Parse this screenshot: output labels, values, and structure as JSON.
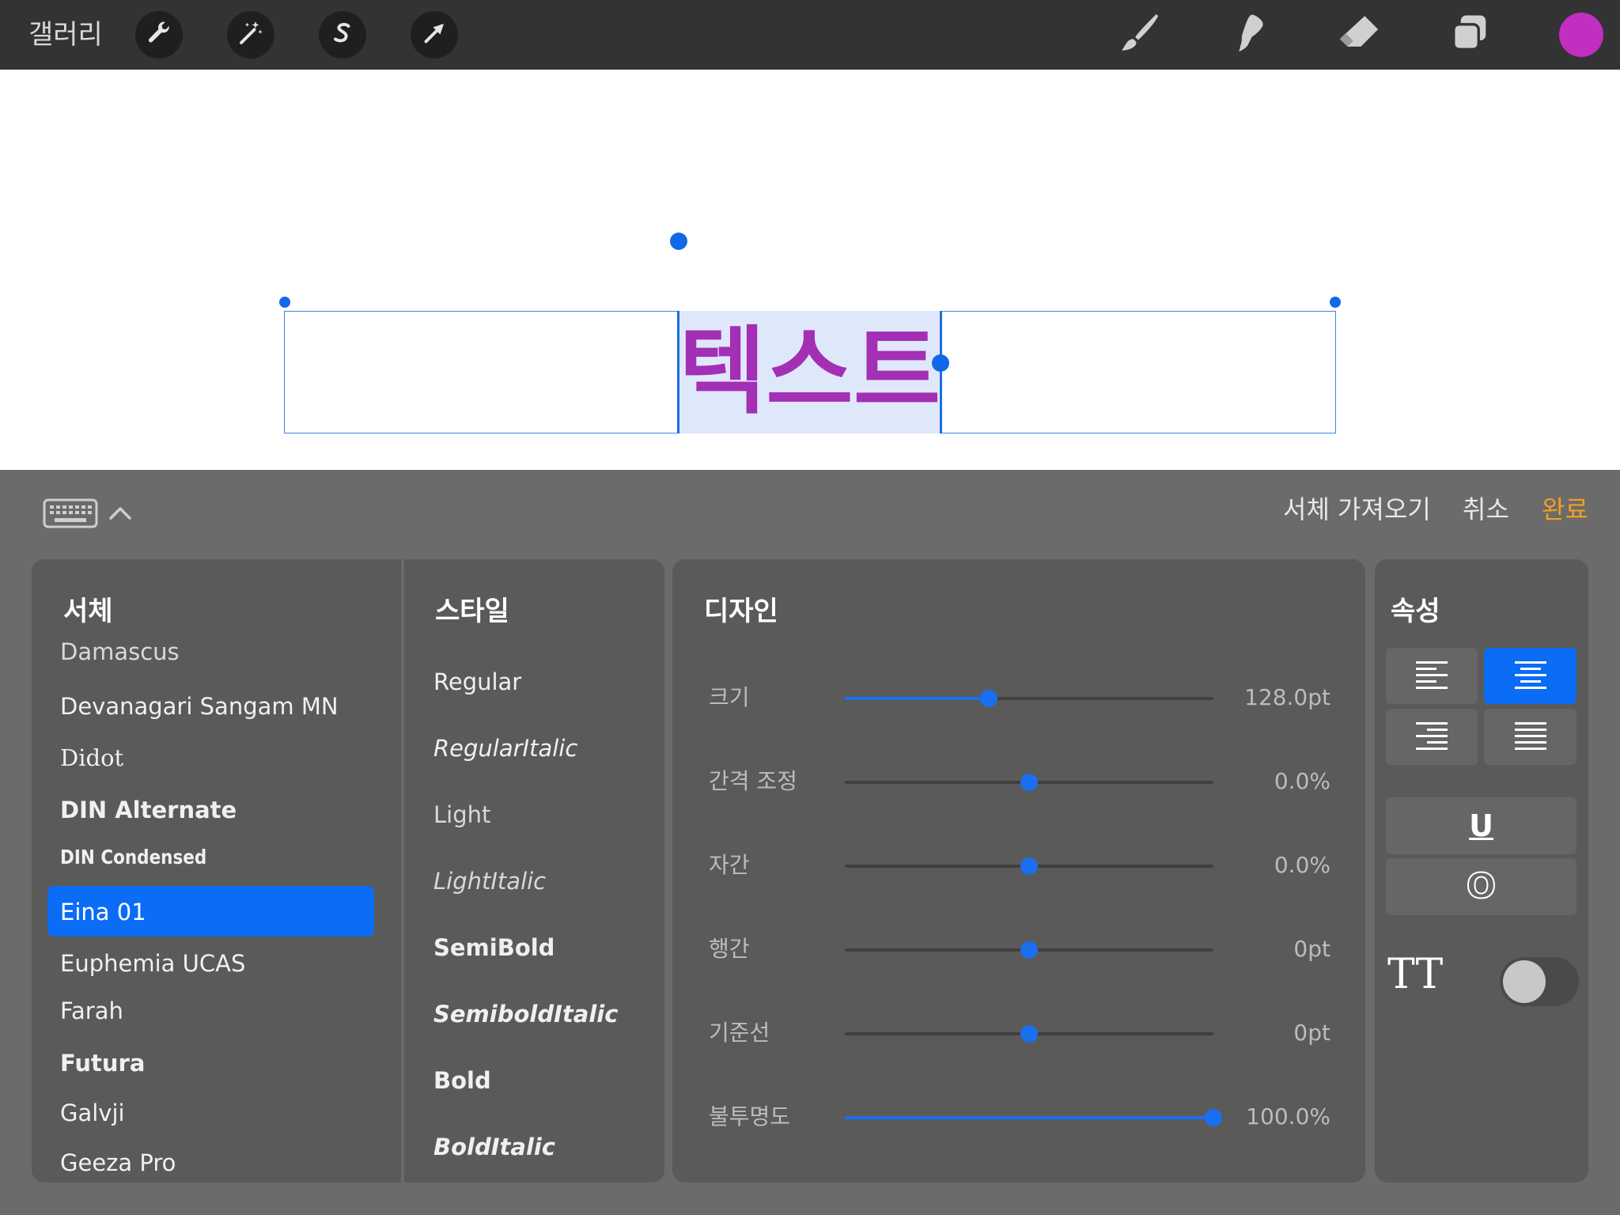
{
  "toolbar": {
    "gallery_label": "갤러리",
    "left_tools": [
      "wrench-icon",
      "magic-wand-icon",
      "selection-s-icon",
      "arrow-icon"
    ],
    "right_tools": [
      "brush-icon",
      "smudge-icon",
      "eraser-icon",
      "layers-icon"
    ],
    "current_color": "#c02fc0"
  },
  "canvas": {
    "text": "텍스트",
    "text_color": "#a32fb5"
  },
  "panel": {
    "actions": {
      "import_font": "서체 가져오기",
      "cancel": "취소",
      "done": "완료"
    },
    "done_color": "#f0a020",
    "fonts": {
      "title": "서체",
      "items": [
        "Damascus",
        "Devanagari Sangam MN",
        "Didot",
        "DIN Alternate",
        "DIN Condensed",
        "Eina 01",
        "Euphemia  UCAS",
        "Farah",
        "Futura",
        "Galvji",
        "Geeza Pro"
      ],
      "selected": "Eina 01"
    },
    "styles": {
      "title": "스타일",
      "items": [
        "Regular",
        "RegularItalic",
        "Light",
        "LightItalic",
        "SemiBold",
        "SemiboldItalic",
        "Bold",
        "BoldItalic"
      ]
    },
    "design": {
      "title": "디자인",
      "rows": [
        {
          "label": "크기",
          "value": "128.0pt",
          "level": 0.39
        },
        {
          "label": "간격 조정",
          "value": "0.0%",
          "level": 0.5
        },
        {
          "label": "자간",
          "value": "0.0%",
          "level": 0.5
        },
        {
          "label": "행간",
          "value": "0pt",
          "level": 0.5
        },
        {
          "label": "기준선",
          "value": "0pt",
          "level": 0.5
        },
        {
          "label": "불투명도",
          "value": "100.0%",
          "level": 1.0
        }
      ]
    },
    "attributes": {
      "title": "속성",
      "alignment_selected": "center",
      "underline_glyph": "U",
      "outline_glyph": "O",
      "caps_label": "TT",
      "caps_enabled": false
    }
  }
}
